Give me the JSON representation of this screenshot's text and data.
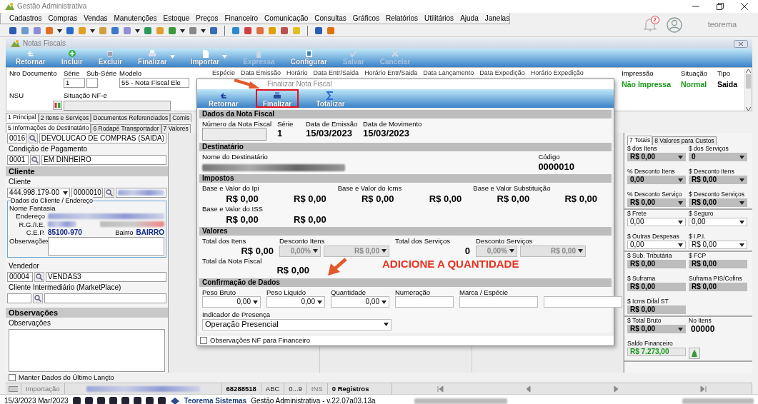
{
  "app": {
    "title": "Gestão Administrativa",
    "notifications": "2",
    "user": "teorema"
  },
  "menu": [
    "Cadastros",
    "Compras",
    "Vendas",
    "Manutenções",
    "Estoque",
    "Preços",
    "Financeiro",
    "Comunicação",
    "Consultas",
    "Gráficos",
    "Relatórios",
    "Utilitários",
    "Ajuda",
    "Janelas"
  ],
  "window": {
    "title": "Notas Fiscais"
  },
  "toolbar": [
    {
      "label": "Retornar",
      "disabled": false,
      "dropdown": false
    },
    {
      "label": "Incluir",
      "disabled": false,
      "dropdown": false
    },
    {
      "label": "Excluir",
      "disabled": false,
      "dropdown": false
    },
    {
      "label": "Finalizar",
      "disabled": false,
      "dropdown": true
    },
    {
      "label": "Importar",
      "disabled": false,
      "dropdown": true
    },
    {
      "label": "Expressa",
      "disabled": true,
      "dropdown": false
    },
    {
      "label": "Configurar",
      "disabled": false,
      "dropdown": false
    },
    {
      "label": "Salvar",
      "disabled": true,
      "dropdown": false
    },
    {
      "label": "Cancelar",
      "disabled": true,
      "dropdown": false
    }
  ],
  "header": {
    "nro_documento": "Nro Documento",
    "serie": {
      "label": "Série",
      "value": "1"
    },
    "sub_serie": {
      "label": "Sub-Série"
    },
    "modelo": {
      "label": "Modelo",
      "value": "55 - Nota Fiscal Ele"
    },
    "nsu": "NSU",
    "situacao_nfe": "Situação NF-e",
    "columns": [
      "Espécie",
      "Data Emissão",
      "Horário",
      "Data Entr/Saida",
      "Horário Entr/Saida",
      "Data Lançamento",
      "Data Expedição",
      "Horário Expedição"
    ],
    "status": [
      {
        "label": "Impressão",
        "value": "Não Impressa",
        "color": "#1a9a1a"
      },
      {
        "label": "Situação",
        "value": "Normal",
        "color": "#1a9a1a"
      },
      {
        "label": "Tipo",
        "value": "Saida",
        "color": "#000000"
      }
    ]
  },
  "tabs": [
    {
      "label": "1 Principal",
      "selected": true
    },
    {
      "label": "2 Itens e Serviços",
      "selected": false
    },
    {
      "label": "Documentos Referenciados",
      "selected": false
    },
    {
      "label": "Comis",
      "selected": false
    }
  ],
  "subtabs": [
    {
      "label": "5 Informações do Destinatário",
      "selected": true
    },
    {
      "label": "6 Rodapé Transportador",
      "selected": false
    },
    {
      "label": "7 Valores",
      "selected": false
    }
  ],
  "left": {
    "operacao": {
      "code": "0016",
      "value": "DEVOLUCAO DE COMPRAS (SAIDA)"
    },
    "pagamento": {
      "label": "Condição de Pagamento",
      "code": "0001",
      "value": "EM DINHEIRO"
    },
    "cliente_section": "Cliente",
    "cliente": {
      "label": "Cliente",
      "document": "444.998.179-00",
      "code": "0000010"
    },
    "endereco": {
      "title": "Dados do Cliente / Endereço",
      "nome_fantasia": "Nome Fantasia",
      "endereco": "Endereço",
      "rg": "R.G./I.E.",
      "cep_label": "C.E.P.",
      "cep": "85100-970",
      "bairro_label": "Bairro",
      "bairro": "BAIRRO",
      "obs": "Observações"
    },
    "vendedor": {
      "label": "Vendedor",
      "code": "00004",
      "value": "VENDAS3"
    },
    "intermediario": {
      "label": "Cliente Intermediário (MarketPlace)"
    },
    "obs_section": "Observações",
    "obs_label": "Observações",
    "manter": {
      "label": "Manter Dados do Último Lançto",
      "checked": false
    }
  },
  "totals": {
    "tabs": [
      {
        "label": "7 Totais",
        "selected": true
      },
      {
        "label": "8 Valores para Custos",
        "selected": false
      }
    ],
    "groups": [
      {
        "fields": [
          {
            "label": "$ dos Itens",
            "value": "R$ 0,00",
            "kind": "readonly-dropdown"
          },
          {
            "label": "$ dos Serviços",
            "value": "0",
            "kind": "readonly-dropdown"
          },
          {
            "label": "% Desconto Itens",
            "value": "0,00",
            "kind": "readonly-dropdown"
          },
          {
            "label": "$ Desconto Itens",
            "value": "R$ 0,00",
            "kind": "readonly-dropdown"
          },
          {
            "label": "% Desconto Serviço",
            "value": "R$ 0,00",
            "kind": "readonly-dropdown"
          },
          {
            "label": "$ Desconto Serviços",
            "value": "R$ 0,00",
            "kind": "readonly-dropdown"
          }
        ]
      },
      {
        "fields": [
          {
            "label": "$ Frete",
            "value": "0,00",
            "kind": "input-dropdown"
          },
          {
            "label": "$ Seguro",
            "value": "0,00",
            "kind": "input-dropdown"
          },
          {
            "label": "$ Outras Despesas",
            "value": "0,00",
            "kind": "input-dropdown"
          },
          {
            "label": "$ I.P.I.",
            "value": "R$ 0,00",
            "kind": "input-dropdown"
          }
        ]
      },
      {
        "fields": [
          {
            "label": "$ Sub. Tributária",
            "value": "R$ 0,00",
            "kind": "readonly"
          },
          {
            "label": "$ FCP",
            "value": "R$ 0,00",
            "kind": "readonly"
          },
          {
            "label": "$ Suframa",
            "value": "R$ 0,00",
            "kind": "readonly"
          },
          {
            "label": "Suframa PIS/Cofins",
            "value": "R$ 0,00",
            "kind": "readonly"
          },
          {
            "label": "$ Icms Difal ST",
            "value": "R$ 0,00",
            "kind": "readonly"
          }
        ]
      },
      {
        "fields": [
          {
            "label": "$ Total Bruto",
            "value": "R$ 0,00",
            "kind": "readonly-dropdown"
          },
          {
            "label": "No Itens",
            "value": "00000",
            "kind": "plain"
          },
          {
            "label": "Saldo Financeiro",
            "value": "R$ 7.273,00",
            "kind": "balance"
          }
        ]
      }
    ]
  },
  "dialog": {
    "title": "Finalizar Nota Fiscal",
    "toolbar": [
      {
        "label": "Retornar",
        "highlighted": false
      },
      {
        "label": "Finalizar",
        "highlighted": true
      },
      {
        "label": "Totalizar",
        "highlighted": false
      }
    ],
    "dados": {
      "title": "Dados da Nota Fiscal",
      "numero": "Número da Nota Fiscal",
      "serie": {
        "label": "Série",
        "value": "1"
      },
      "emissao": {
        "label": "Data de Emissão",
        "value": "15/03/2023"
      },
      "movimento": {
        "label": "Data de Movimento",
        "value": "15/03/2023"
      }
    },
    "destinatario": {
      "title": "Destinatário",
      "nome": "Nome do Destinatário",
      "codigo": {
        "label": "Código",
        "value": "0000010"
      }
    },
    "impostos": {
      "title": "Impostos",
      "groups": [
        {
          "label": "Base e Valor do Ipi",
          "values": [
            "R$ 0,00",
            "R$ 0,00"
          ]
        },
        {
          "label": "Base e Valor do Icms",
          "values": [
            "R$ 0,00",
            "R$ 0,00"
          ]
        },
        {
          "label": "Base e Valor Substituição",
          "values": [
            "R$ 0,00",
            "R$ 0,00"
          ]
        },
        {
          "label": "Base e Valor do ISS",
          "values": [
            "R$ 0,00",
            "R$ 0,00"
          ]
        }
      ]
    },
    "valores": {
      "title": "Valores",
      "total_itens": {
        "label": "Total dos Itens",
        "value": "R$ 0,00"
      },
      "desconto_itens": {
        "label": "Desconto Itens",
        "percent": "0,00%",
        "value": "R$ 0,00"
      },
      "total_servicos": {
        "label": "Total dos Serviços",
        "value": "0"
      },
      "desconto_servicos": {
        "label": "Desconto Serviços",
        "percent": "0,00%",
        "value": "R$ 0,00"
      },
      "total_nota": {
        "label": "Total da Nota Fiscal",
        "value": "R$ 0,00"
      }
    },
    "annotation": "ADICIONE A QUANTIDADE",
    "confirmacao": {
      "title": "Confirmação de Dados",
      "fields": [
        {
          "label": "Peso Bruto",
          "value": "0,00",
          "kind": "number"
        },
        {
          "label": "Peso Liquido",
          "value": "0,00",
          "kind": "number"
        },
        {
          "label": "Quantidade",
          "value": "0,00",
          "kind": "number"
        },
        {
          "label": "Numeração",
          "kind": "text"
        },
        {
          "label": "Marca / Espécie",
          "kind": "text"
        },
        {
          "kind": "text"
        }
      ],
      "presenca": {
        "label": "Indicador de Presença",
        "value": "Operação Presencial"
      }
    },
    "obs_financeiro": {
      "label": "Observações NF para Financeiro",
      "checked": false
    }
  },
  "status_bar": {
    "module": "Importação",
    "code": "68288518",
    "indicators": [
      {
        "label": "ABC",
        "enabled": true
      },
      {
        "label": "0...9",
        "enabled": true
      },
      {
        "label": "INS",
        "enabled": false
      }
    ],
    "records": "0 Registros"
  },
  "taskbar": {
    "date": "15/3/2023 Mar/2023",
    "company": "Teorema Sistemas",
    "version": "Gestão Administrativa - v.22.07a03.13a"
  }
}
